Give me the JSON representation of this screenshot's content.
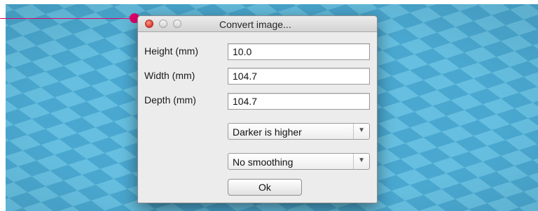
{
  "dialog": {
    "title": "Convert image...",
    "fields": [
      {
        "label": "Height (mm)",
        "value": "10.0"
      },
      {
        "label": "Width (mm)",
        "value": "104.7"
      },
      {
        "label": "Depth (mm)",
        "value": "104.7"
      }
    ],
    "height_mode": {
      "selected": "Darker is higher"
    },
    "smoothing": {
      "selected": "No smoothing"
    },
    "ok_label": "Ok"
  },
  "colors": {
    "annotation": "#e0006a",
    "checker_light": "#66bfe0",
    "checker_dark": "#4aa8d0",
    "close_button": "#e0443a"
  },
  "icons": {
    "close": "red-circle",
    "minimize": "gray-circle",
    "zoom": "gray-circle",
    "dropdown": "chevron-down"
  }
}
